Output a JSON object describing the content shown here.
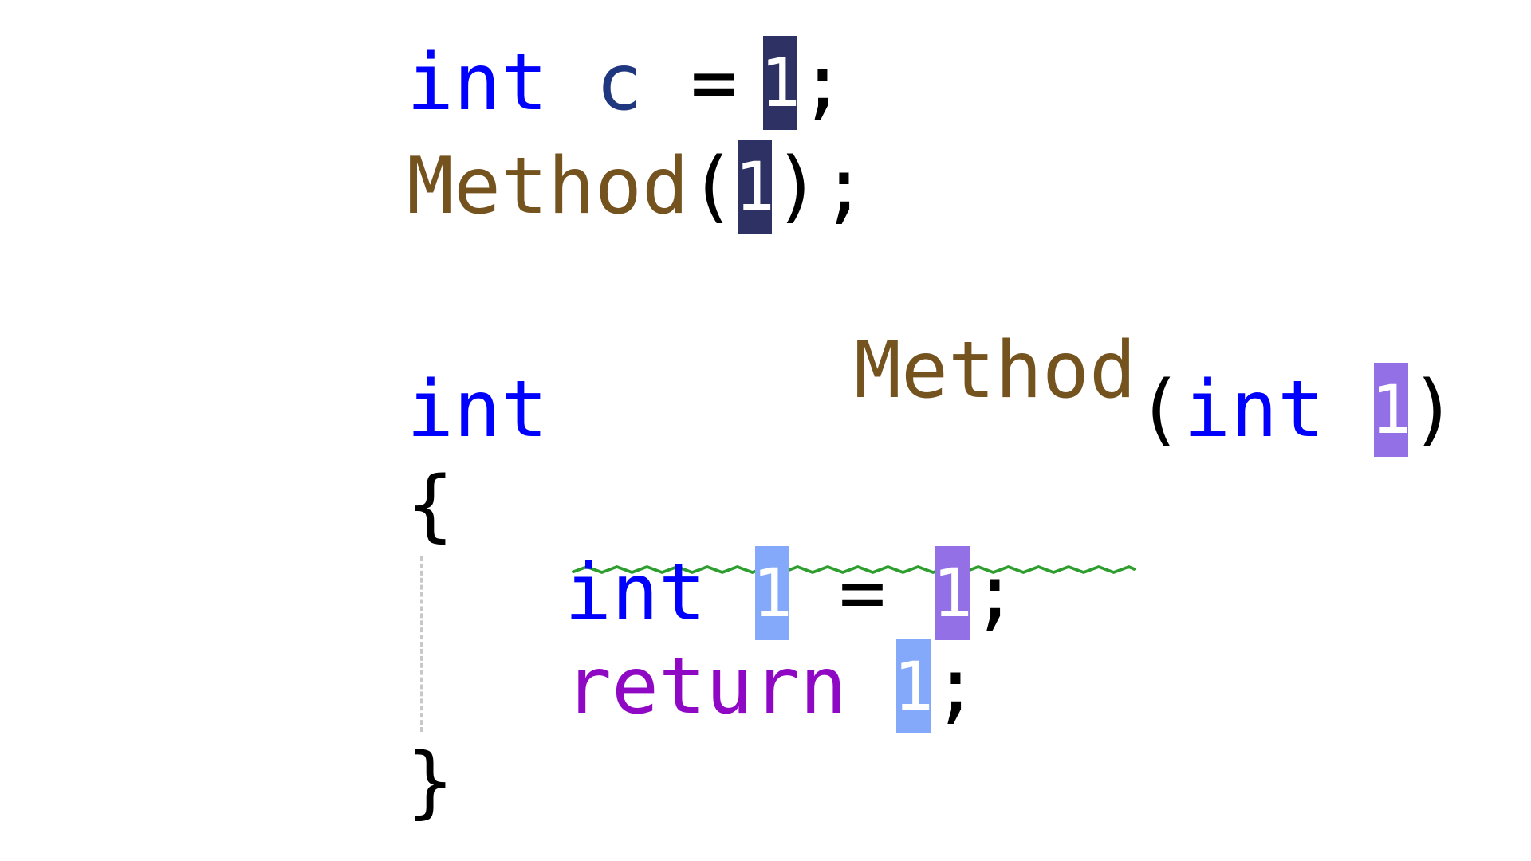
{
  "editor": {
    "line1": {
      "keyword": "int",
      "variable": "c",
      "operator": "=",
      "hint": "1",
      "terminator": ";"
    },
    "line2": {
      "function": "Method",
      "open_paren": "(",
      "hint": "1",
      "close": ");"
    },
    "line3": {
      "keyword": "int",
      "function": "Method",
      "open_paren": "(",
      "param_type": "int",
      "hint": "1",
      "close_paren": ")"
    },
    "line4": {
      "brace": "{"
    },
    "line5": {
      "keyword": "int",
      "hint_left": "1",
      "operator": "=",
      "hint_right": "1",
      "terminator": ";"
    },
    "line6": {
      "keyword": "return",
      "hint": "1",
      "terminator": ";"
    },
    "line7": {
      "brace": "}"
    },
    "colors": {
      "keyword": "#0000ff",
      "variable": "#1f377f",
      "function": "#74531f",
      "control": "#8f08c4",
      "hint_dark": "#2d3163",
      "hint_purple": "#9370e5",
      "hint_blue": "#84a9fb",
      "squiggle": "#2e9e2e"
    }
  }
}
